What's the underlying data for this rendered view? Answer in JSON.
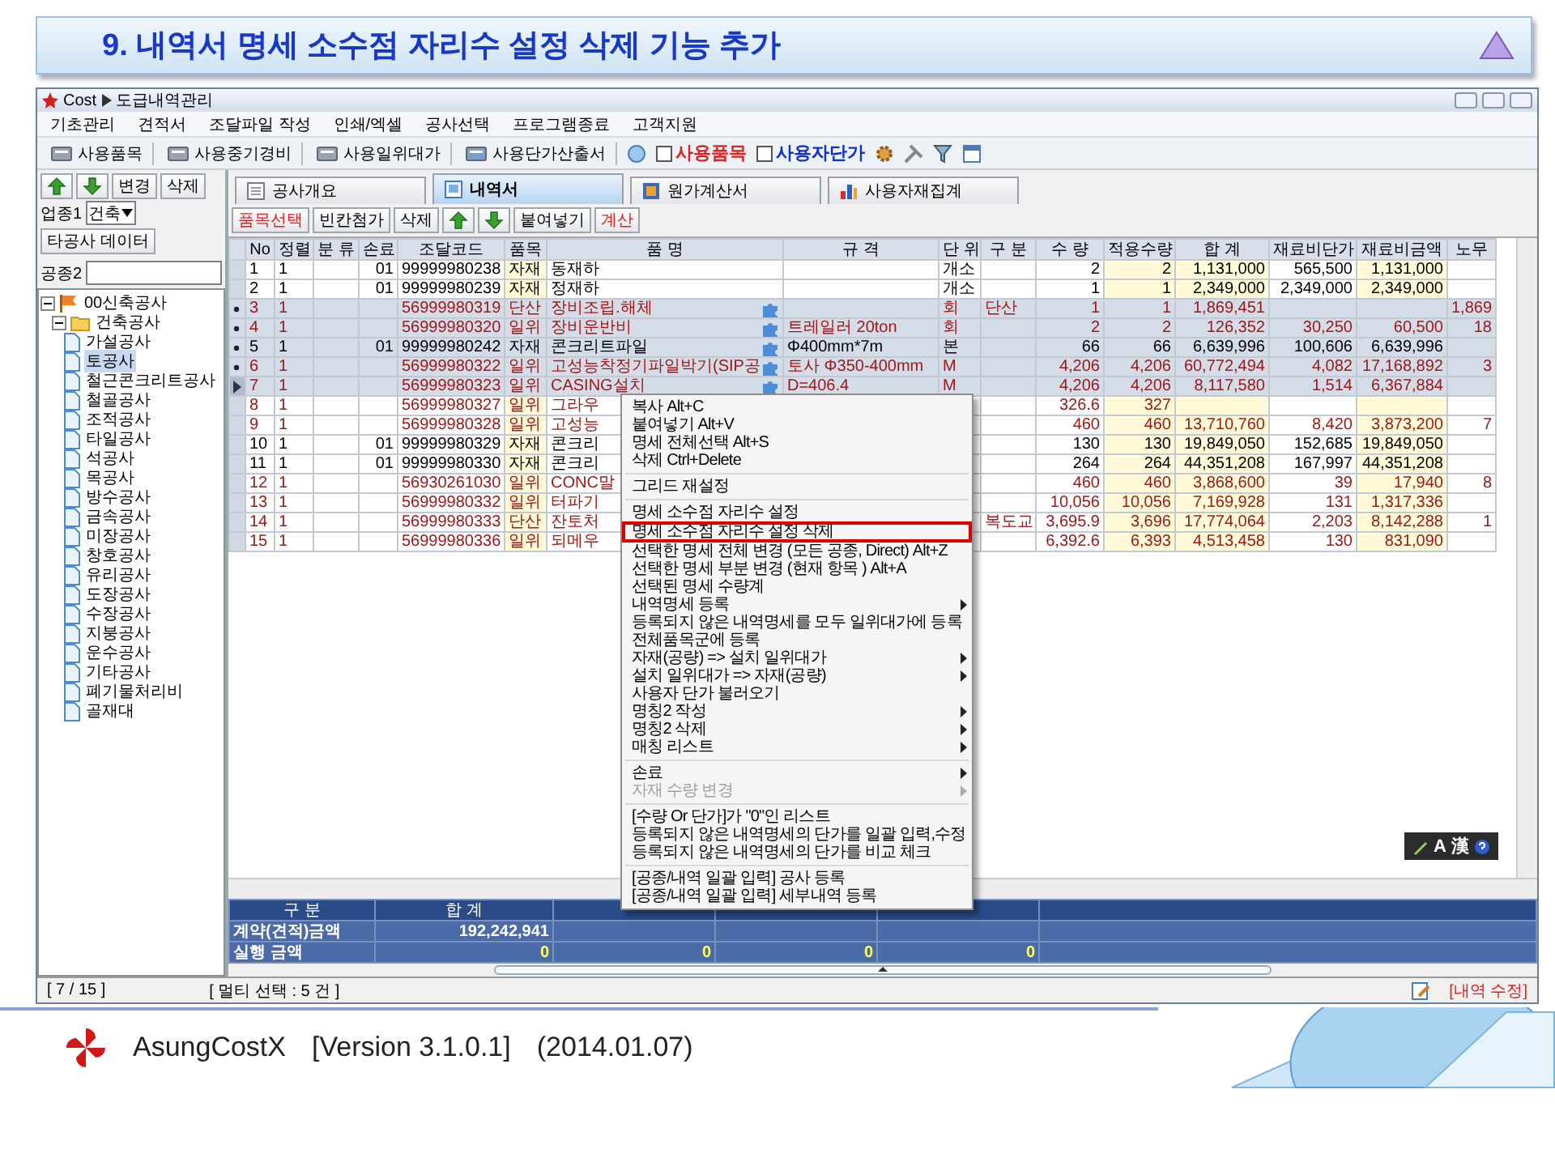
{
  "slide": {
    "title": "9. 내역서 명세 소수점 자리수 설정 삭제 기능 추가"
  },
  "app": {
    "title": "Cost",
    "subtitle": "도급내역관리",
    "menu_bar": [
      "기초관리",
      "견적서",
      "조달파일 작성",
      "인쇄/엑셀",
      "공사선택",
      "프로그램종료",
      "고객지원"
    ],
    "toolbar": {
      "buttons": [
        "사용품목",
        "사용중기경비",
        "사용일위대가",
        "사용단가산출서"
      ],
      "checkboxes": [
        {
          "label": "사용품목",
          "checked": false,
          "color": "#e02020"
        },
        {
          "label": "사용자단가",
          "checked": false,
          "color": "#1030d0"
        }
      ]
    },
    "left_panel": {
      "buttons": [
        "변경",
        "삭제"
      ],
      "trade_label": "업종1",
      "trade_value": "건축",
      "other_data_button": "타공사 데이터",
      "work_label": "공종2",
      "tree": [
        {
          "label": "00신축공사",
          "expanded": true,
          "selected": false,
          "children": [
            {
              "label": "건축공사",
              "expanded": true,
              "selected": false,
              "children": [
                {
                  "label": "가설공사",
                  "selected": false
                },
                {
                  "label": "토공사",
                  "selected": true
                },
                {
                  "label": "철근콘크리트공사",
                  "selected": false
                },
                {
                  "label": "철골공사",
                  "selected": false
                },
                {
                  "label": "조적공사",
                  "selected": false
                },
                {
                  "label": "타일공사",
                  "selected": false
                },
                {
                  "label": "석공사",
                  "selected": false
                },
                {
                  "label": "목공사",
                  "selected": false
                },
                {
                  "label": "방수공사",
                  "selected": false
                },
                {
                  "label": "금속공사",
                  "selected": false
                },
                {
                  "label": "미장공사",
                  "selected": false
                },
                {
                  "label": "창호공사",
                  "selected": false
                },
                {
                  "label": "유리공사",
                  "selected": false
                },
                {
                  "label": "도장공사",
                  "selected": false
                },
                {
                  "label": "수장공사",
                  "selected": false
                },
                {
                  "label": "지붕공사",
                  "selected": false
                },
                {
                  "label": "운수공사",
                  "selected": false
                },
                {
                  "label": "기타공사",
                  "selected": false
                },
                {
                  "label": "폐기물처리비",
                  "selected": false
                },
                {
                  "label": "골재대",
                  "selected": false
                }
              ]
            }
          ]
        }
      ]
    },
    "tabs": [
      {
        "label": "공사개요",
        "selected": false
      },
      {
        "label": "내역서",
        "selected": true
      },
      {
        "label": "원가계산서",
        "selected": false
      },
      {
        "label": "사용자재집계",
        "selected": false
      }
    ],
    "action_buttons": [
      {
        "kind": "text",
        "label": "품목선택",
        "color": "#e02020"
      },
      {
        "kind": "text",
        "label": "빈칸첨가",
        "color": "#000000"
      },
      {
        "kind": "text",
        "label": "삭제",
        "color": "#000000"
      },
      {
        "kind": "up"
      },
      {
        "kind": "down"
      },
      {
        "kind": "text",
        "label": "붙여넣기",
        "color": "#000000"
      },
      {
        "kind": "text",
        "label": "계산",
        "color": "#e02020"
      }
    ],
    "grid": {
      "columns": [
        "No",
        "정렬",
        "분 류",
        "손료",
        "조달코드",
        "품목",
        "품 명",
        "규 격",
        "단 위",
        "구 분",
        "수 량",
        "적용수량",
        "합 계",
        "재료비단가",
        "재료비금액",
        "노무"
      ],
      "rows": [
        {
          "selected": false,
          "current": false,
          "linked": false,
          "kind": "material",
          "no": "1",
          "sort": "1",
          "rental": "01",
          "code": "99999980238",
          "type": "자재",
          "name": "동재하",
          "unit": "개소",
          "qty": "2",
          "applied": "2",
          "total": "1,131,000",
          "unit_price": "565,500",
          "amount": "1,131,000"
        },
        {
          "selected": false,
          "current": false,
          "linked": false,
          "kind": "material",
          "no": "2",
          "sort": "1",
          "rental": "01",
          "code": "99999980239",
          "type": "자재",
          "name": "정재하",
          "unit": "개소",
          "qty": "1",
          "applied": "1",
          "total": "2,349,000",
          "unit_price": "2,349,000",
          "amount": "2,349,000"
        },
        {
          "selected": true,
          "current": false,
          "linked": true,
          "kind": "composite",
          "no": "3",
          "sort": "1",
          "code": "56999980319",
          "type": "단산",
          "name": "장비조립.해체",
          "unit": "회",
          "division": "단산",
          "qty": "1",
          "applied": "1",
          "total": "1,869,451",
          "labor": "1,869"
        },
        {
          "selected": true,
          "current": false,
          "linked": true,
          "kind": "composite",
          "no": "4",
          "sort": "1",
          "code": "56999980320",
          "type": "일위",
          "name": "장비운반비",
          "spec": "트레일러 20ton",
          "unit": "회",
          "qty": "2",
          "applied": "2",
          "total": "126,352",
          "unit_price": "30,250",
          "amount": "60,500",
          "labor": "18"
        },
        {
          "selected": true,
          "current": false,
          "linked": true,
          "kind": "material",
          "no": "5",
          "sort": "1",
          "rental": "01",
          "code": "99999980242",
          "type": "자재",
          "name": "콘크리트파일",
          "spec": "Φ400mm*7m",
          "unit": "본",
          "qty": "66",
          "applied": "66",
          "total": "6,639,996",
          "unit_price": "100,606",
          "amount": "6,639,996"
        },
        {
          "selected": true,
          "current": false,
          "linked": true,
          "kind": "composite",
          "no": "6",
          "sort": "1",
          "code": "56999980322",
          "type": "일위",
          "name": "고성능착정기파일박기(SIP공",
          "spec": "토사 Φ350-400mm",
          "unit": "M",
          "qty": "4,206",
          "applied": "4,206",
          "total": "60,772,494",
          "unit_price": "4,082",
          "amount": "17,168,892",
          "labor": "3"
        },
        {
          "selected": true,
          "current": true,
          "linked": true,
          "kind": "composite",
          "no": "7",
          "sort": "1",
          "code": "56999980323",
          "type": "일위",
          "name": "CASING설치",
          "spec": "D=406.4",
          "unit": "M",
          "qty": "4,206",
          "applied": "4,206",
          "total": "8,117,580",
          "unit_price": "1,514",
          "amount": "6,367,884"
        },
        {
          "selected": false,
          "current": false,
          "kind": "composite",
          "no": "8",
          "sort": "1",
          "code": "56999980327",
          "type": "일위",
          "name": "그라우",
          "qty": "326.6",
          "applied": "327"
        },
        {
          "selected": false,
          "current": false,
          "kind": "composite",
          "no": "9",
          "sort": "1",
          "code": "56999980328",
          "type": "일위",
          "name": "고성능",
          "qty": "460",
          "applied": "460",
          "total": "13,710,760",
          "unit_price": "8,420",
          "amount": "3,873,200",
          "labor": "7"
        },
        {
          "selected": false,
          "current": false,
          "kind": "material",
          "no": "10",
          "sort": "1",
          "rental": "01",
          "code": "99999980329",
          "type": "자재",
          "name": "콘크리",
          "qty": "130",
          "applied": "130",
          "total": "19,849,050",
          "unit_price": "152,685",
          "amount": "19,849,050"
        },
        {
          "selected": false,
          "current": false,
          "kind": "material",
          "no": "11",
          "sort": "1",
          "rental": "01",
          "code": "99999980330",
          "type": "자재",
          "name": "콘크리",
          "qty": "264",
          "applied": "264",
          "total": "44,351,208",
          "unit_price": "167,997",
          "amount": "44,351,208"
        },
        {
          "selected": false,
          "current": false,
          "kind": "composite",
          "no": "12",
          "sort": "1",
          "code": "56930261030",
          "type": "일위",
          "name": "CONC말",
          "qty": "460",
          "applied": "460",
          "total": "3,868,600",
          "unit_price": "39",
          "amount": "17,940",
          "labor": "8"
        },
        {
          "selected": false,
          "current": false,
          "kind": "composite",
          "no": "13",
          "sort": "1",
          "code": "56999980332",
          "type": "일위",
          "name": "터파기",
          "qty": "10,056",
          "applied": "10,056",
          "total": "7,169,928",
          "unit_price": "131",
          "amount": "1,317,336"
        },
        {
          "selected": false,
          "current": false,
          "kind": "composite",
          "no": "14",
          "sort": "1",
          "code": "56999980333",
          "type": "단산",
          "name": "잔토처",
          "division": "복도교",
          "qty": "3,695.9",
          "applied": "3,696",
          "total": "17,774,064",
          "unit_price": "2,203",
          "amount": "8,142,288",
          "labor": "1"
        },
        {
          "selected": false,
          "current": false,
          "kind": "composite",
          "no": "15",
          "sort": "1",
          "code": "56999980336",
          "type": "일위",
          "name": "되메우",
          "qty": "6,392.6",
          "applied": "6,393",
          "total": "4,513,458",
          "unit_price": "130",
          "amount": "831,090"
        }
      ]
    },
    "context_menu": {
      "groups": [
        {
          "items": [
            {
              "label": "복사 Alt+C",
              "submenu": false,
              "disabled": false,
              "marked": false
            },
            {
              "label": "붙여넣기 Alt+V",
              "submenu": false,
              "disabled": false,
              "marked": false
            },
            {
              "label": "명세 전체선택 Alt+S",
              "submenu": false,
              "disabled": false,
              "marked": false
            },
            {
              "label": "삭제 Ctrl+Delete",
              "submenu": false,
              "disabled": false,
              "marked": false
            }
          ]
        },
        {
          "items": [
            {
              "label": "그리드 재설정",
              "submenu": false,
              "disabled": false,
              "marked": false
            }
          ]
        },
        {
          "items": [
            {
              "label": "명세 소수점 자리수 설정",
              "submenu": false,
              "disabled": false,
              "marked": false
            },
            {
              "label": "명세 소수점 자리수 설정 삭제",
              "submenu": false,
              "disabled": false,
              "marked": true
            },
            {
              "label": "선택한 명세 전체 변경 (모든 공종, Direct) Alt+Z",
              "submenu": false,
              "disabled": false,
              "marked": false
            },
            {
              "label": "선택한 명세 부분 변경 (현재 항목 ) Alt+A",
              "submenu": false,
              "disabled": false,
              "marked": false
            },
            {
              "label": "선택된 명세 수량계",
              "submenu": false,
              "disabled": false,
              "marked": false
            },
            {
              "label": "내역명세 등록",
              "submenu": true,
              "disabled": false,
              "marked": false
            },
            {
              "label": "등록되지 않은 내역명세를 모두 일위대가에 등록",
              "submenu": false,
              "disabled": false,
              "marked": false
            },
            {
              "label": "전체품목군에 등록",
              "submenu": false,
              "disabled": false,
              "marked": false
            },
            {
              "label": "자재(공량) => 설치 일위대가",
              "submenu": true,
              "disabled": false,
              "marked": false
            },
            {
              "label": "설치 일위대가 => 자재(공량)",
              "submenu": true,
              "disabled": false,
              "marked": false
            },
            {
              "label": "사용자 단가 불러오기",
              "submenu": false,
              "disabled": false,
              "marked": false
            },
            {
              "label": "명칭2 작성",
              "submenu": true,
              "disabled": false,
              "marked": false
            },
            {
              "label": "명칭2 삭제",
              "submenu": true,
              "disabled": false,
              "marked": false
            },
            {
              "label": "매칭 리스트",
              "submenu": true,
              "disabled": false,
              "marked": false
            }
          ]
        },
        {
          "items": [
            {
              "label": "손료",
              "submenu": true,
              "disabled": false,
              "marked": false
            },
            {
              "label": "자재 수량 변경",
              "submenu": true,
              "disabled": true,
              "marked": false
            }
          ]
        },
        {
          "items": [
            {
              "label": "[수량 Or 단가]가 \"0\"인 리스트",
              "submenu": false,
              "disabled": false,
              "marked": false
            },
            {
              "label": "등록되지 않은 내역명세의 단가를 일괄 입력,수정",
              "submenu": false,
              "disabled": false,
              "marked": false
            },
            {
              "label": "등록되지 않은 내역명세의 단가를 비교 체크",
              "submenu": false,
              "disabled": false,
              "marked": false
            }
          ]
        },
        {
          "items": [
            {
              "label": "[공종/내역 일괄 입력] 공사 등록",
              "submenu": false,
              "disabled": false,
              "marked": false
            },
            {
              "label": "[공종/내역 일괄 입력] 세부내역 등록",
              "submenu": false,
              "disabled": false,
              "marked": false
            }
          ]
        }
      ]
    },
    "summary": {
      "columns": [
        "구 분",
        "합 계"
      ],
      "contract": {
        "label": "계약(견적)금액",
        "values": [
          "192,242,941"
        ]
      },
      "execution": {
        "label": "실행 금액",
        "values": [
          "0",
          "0",
          "0",
          "0"
        ]
      }
    },
    "ime_bar": {
      "labels": [
        "A",
        "漢"
      ]
    },
    "status_bar": {
      "position": "[ 7 / 15 ]",
      "selection": "[ 멀티 선택 : 5 건 ]",
      "mode": "[내역 수정]"
    }
  },
  "footer": {
    "product": "AsungCostX",
    "version": "[Version 3.1.0.1]",
    "date": "(2014.01.07)"
  }
}
